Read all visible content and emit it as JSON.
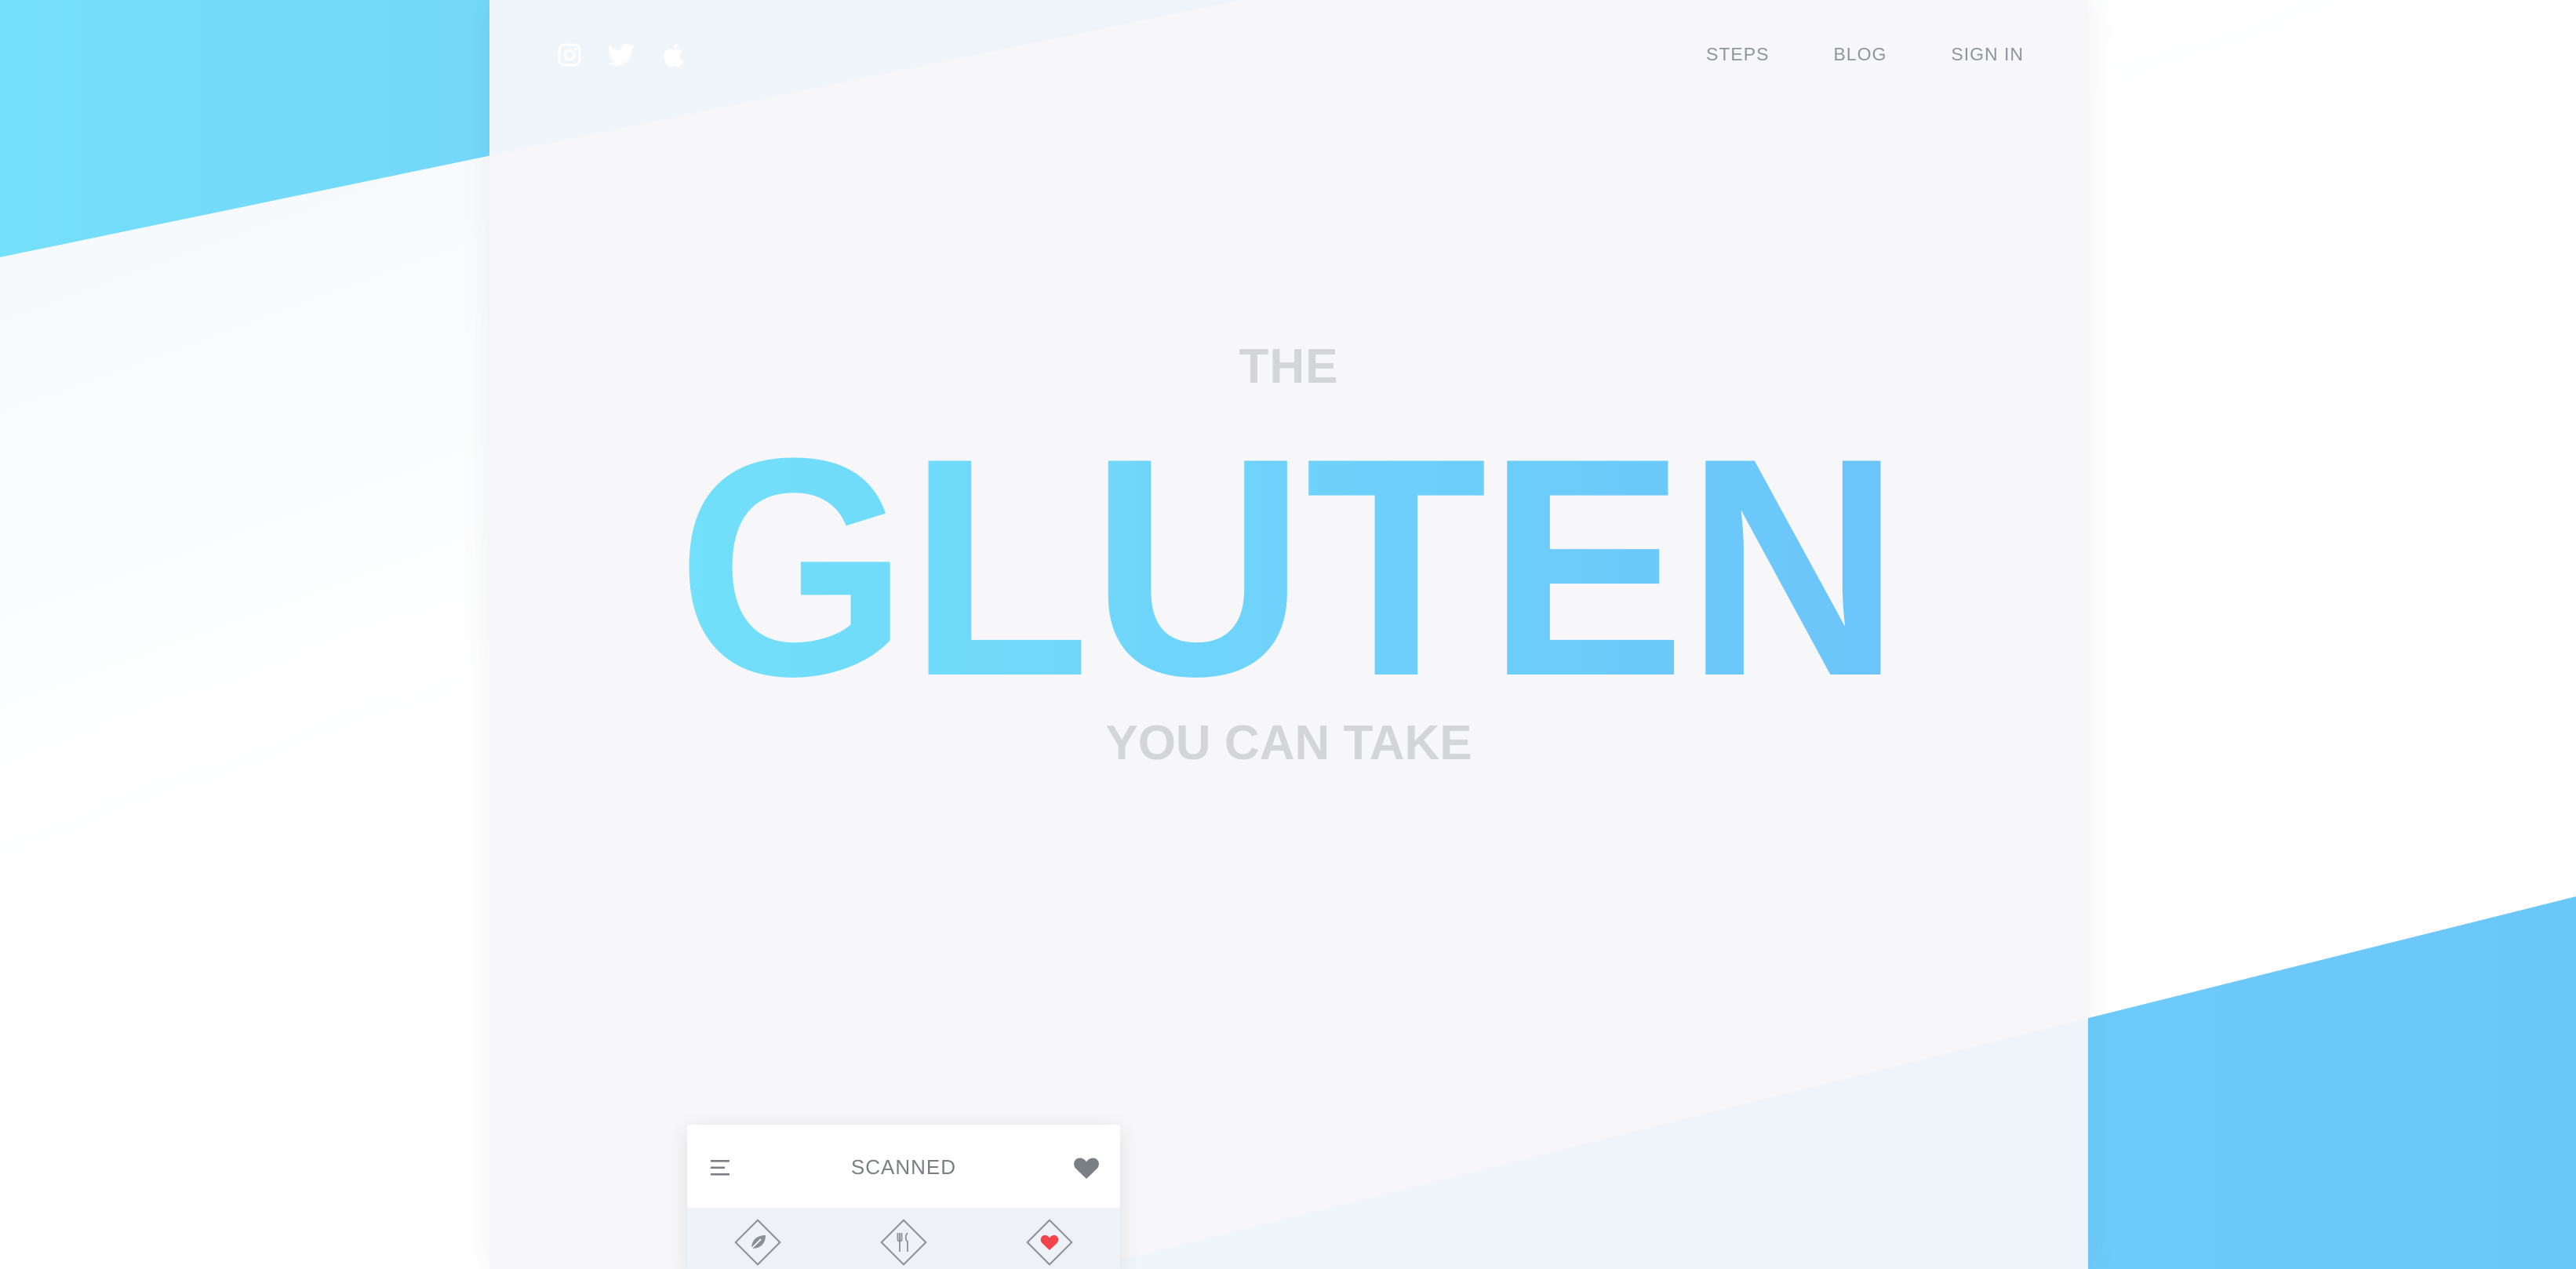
{
  "colors": {
    "accent_start": "#72dffa",
    "accent_end": "#6bc5fa",
    "muted_text": "#d3d5d9",
    "nav_text": "#8f949a",
    "heart_red": "#f2444b"
  },
  "social": [
    {
      "icon": "instagram-icon"
    },
    {
      "icon": "twitter-icon"
    },
    {
      "icon": "apple-icon"
    }
  ],
  "nav": {
    "items": [
      "STEPS",
      "BLOG",
      "SIGN IN"
    ]
  },
  "hero": {
    "pre": "THE",
    "title": "GLUTEN",
    "sub": "YOU CAN TAKE"
  },
  "phone": {
    "title": "SCANNED",
    "menu_icon": "menu-icon",
    "favorite_icon": "heart-icon",
    "tabs": [
      {
        "icon": "leaf-icon"
      },
      {
        "icon": "fork-knife-icon"
      },
      {
        "icon": "heart-icon"
      }
    ]
  }
}
